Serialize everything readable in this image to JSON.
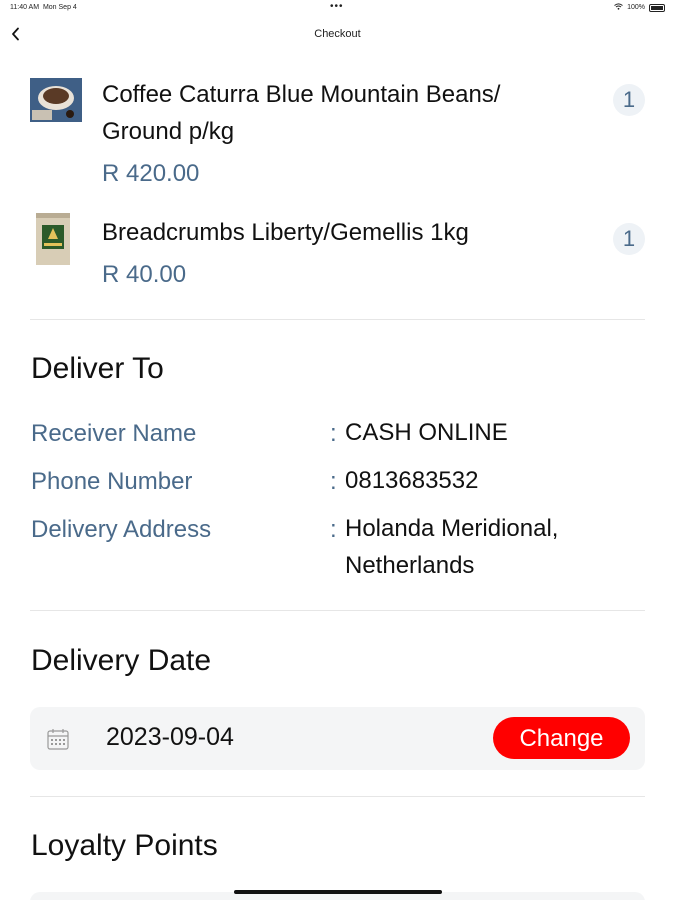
{
  "status_bar": {
    "time": "11:40 AM",
    "date": "Mon Sep 4",
    "center_dots": "•••",
    "wifi_icon": "wifi-icon",
    "battery": "100%"
  },
  "nav": {
    "back_icon": "chevron-left-icon",
    "title": "Checkout"
  },
  "cart": {
    "items": [
      {
        "name": "Coffee Caturra Blue Mountain Beans/ Ground p/kg",
        "price": "R 420.00",
        "quantity": "1"
      },
      {
        "name": "Breadcrumbs Liberty/Gemellis 1kg",
        "price": "R 40.00",
        "quantity": "1"
      }
    ]
  },
  "deliver_to": {
    "title": "Deliver To",
    "fields": [
      {
        "label": "Receiver Name",
        "colon": ":",
        "value": "CASH ONLINE"
      },
      {
        "label": "Phone Number",
        "colon": ":",
        "value": "0813683532"
      },
      {
        "label": "Delivery Address",
        "colon": ":",
        "value": "Holanda Meridional, Netherlands"
      }
    ]
  },
  "delivery_date": {
    "title": "Delivery Date",
    "calendar_icon": "calendar-icon",
    "value": "2023-09-04",
    "change_label": "Change"
  },
  "loyalty": {
    "title": "Loyalty Points"
  },
  "colors": {
    "accent_red": "#ff0000",
    "label_blue": "#4a6a8a",
    "panel_bg": "#f4f5f6"
  }
}
